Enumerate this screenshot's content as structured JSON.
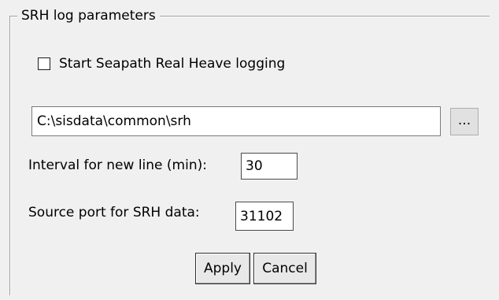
{
  "group": {
    "title": "SRH log parameters"
  },
  "logging": {
    "label": "Start Seapath Real Heave logging",
    "checked": false
  },
  "path": {
    "value": "C:\\sisdata\\common\\srh",
    "browse_label": "..."
  },
  "interval": {
    "label": "Interval for new line (min):",
    "value": "30"
  },
  "port": {
    "label": "Source port for SRH data:",
    "value": "31102"
  },
  "buttons": {
    "apply": "Apply",
    "cancel": "Cancel"
  }
}
